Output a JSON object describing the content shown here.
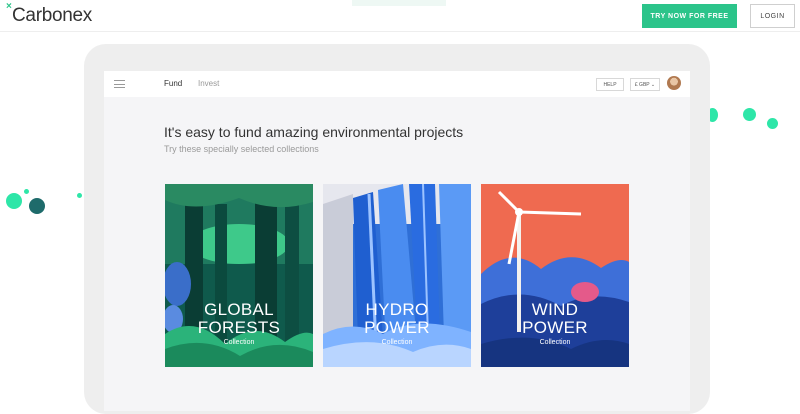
{
  "brand": {
    "name": "Carbonex",
    "mark": "×"
  },
  "topbar": {
    "try_label": "TRY NOW FOR FREE",
    "login_label": "LOGIN"
  },
  "app_nav": {
    "fund": "Fund",
    "invest": "Invest",
    "help": "HELP",
    "currency": "£ GBP ⌄"
  },
  "hero": {
    "headline": "It's easy to fund amazing environmental projects",
    "subline": "Try these specially selected collections"
  },
  "collections": [
    {
      "line1": "GLOBAL",
      "line2": "FORESTS",
      "sub": "Collection"
    },
    {
      "line1": "HYDRO",
      "line2": "POWER",
      "sub": "Collection"
    },
    {
      "line1": "WIND",
      "line2": "POWER",
      "sub": "Collection"
    }
  ],
  "colors": {
    "accent": "#2bc48a",
    "dark_teal": "#1e6b6b"
  }
}
